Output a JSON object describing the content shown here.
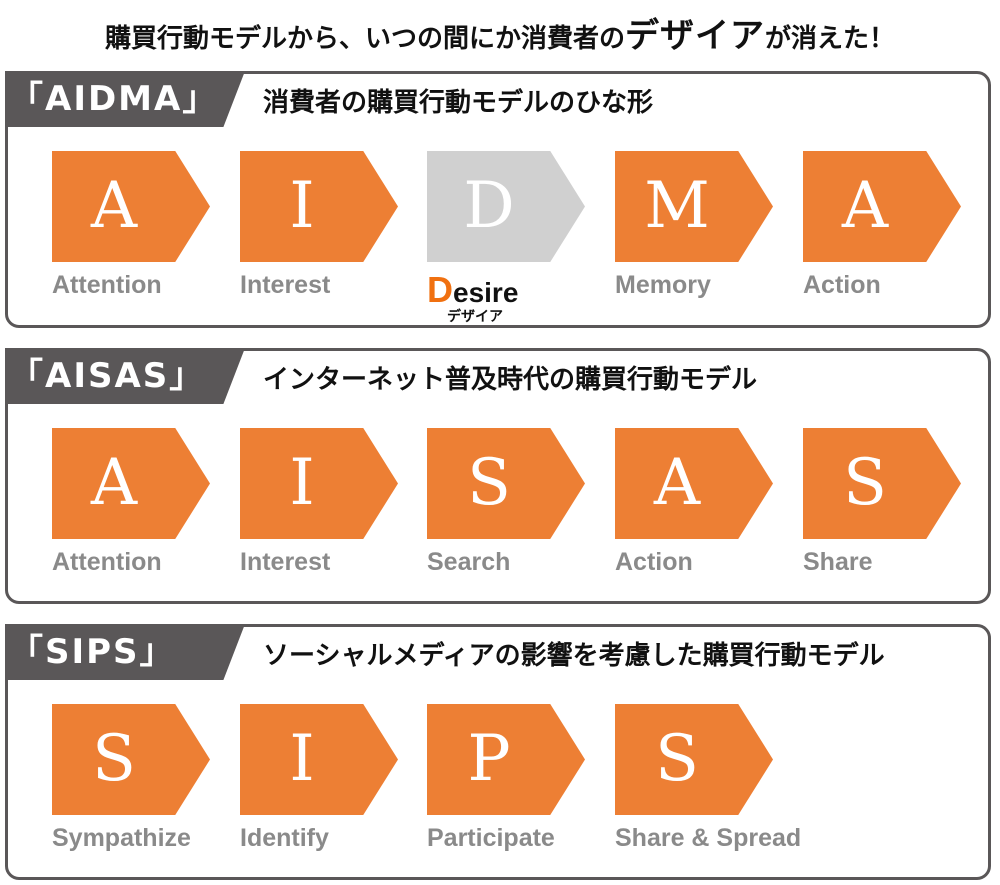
{
  "headline": {
    "before": "購買行動モデルから、いつの間にか消費者の",
    "emphasis": "デザイア",
    "after": "が消えた！"
  },
  "colors": {
    "accent_orange": "#ed7f34",
    "desire_letter_orange": "#f07010",
    "muted_gray_box": "#d0d0d0",
    "tab_dark_gray": "#5a5758",
    "label_gray": "#8a8a8a"
  },
  "models": [
    {
      "tab": "「AIDMA」",
      "subtitle": "消費者の購買行動モデルのひな形",
      "steps": [
        {
          "letter": "A",
          "label": "Attention"
        },
        {
          "letter": "I",
          "label": "Interest"
        },
        {
          "letter": "D",
          "label_first": "D",
          "label_rest": "esire",
          "kana": "デザイア",
          "muted": true
        },
        {
          "letter": "M",
          "label": "Memory"
        },
        {
          "letter": "A",
          "label": "Action"
        }
      ]
    },
    {
      "tab": "「AISAS」",
      "subtitle": "インターネット普及時代の購買行動モデル",
      "steps": [
        {
          "letter": "A",
          "label": "Attention"
        },
        {
          "letter": "I",
          "label": "Interest"
        },
        {
          "letter": "S",
          "label": "Search"
        },
        {
          "letter": "A",
          "label": "Action"
        },
        {
          "letter": "S",
          "label": "Share"
        }
      ]
    },
    {
      "tab": "「SIPS」",
      "subtitle": "ソーシャルメディアの影響を考慮した購買行動モデル",
      "steps": [
        {
          "letter": "S",
          "label": "Sympathize"
        },
        {
          "letter": "I",
          "label": "Identify"
        },
        {
          "letter": "P",
          "label": "Participate"
        },
        {
          "letter": "S",
          "label": "Share & Spread"
        }
      ]
    }
  ]
}
